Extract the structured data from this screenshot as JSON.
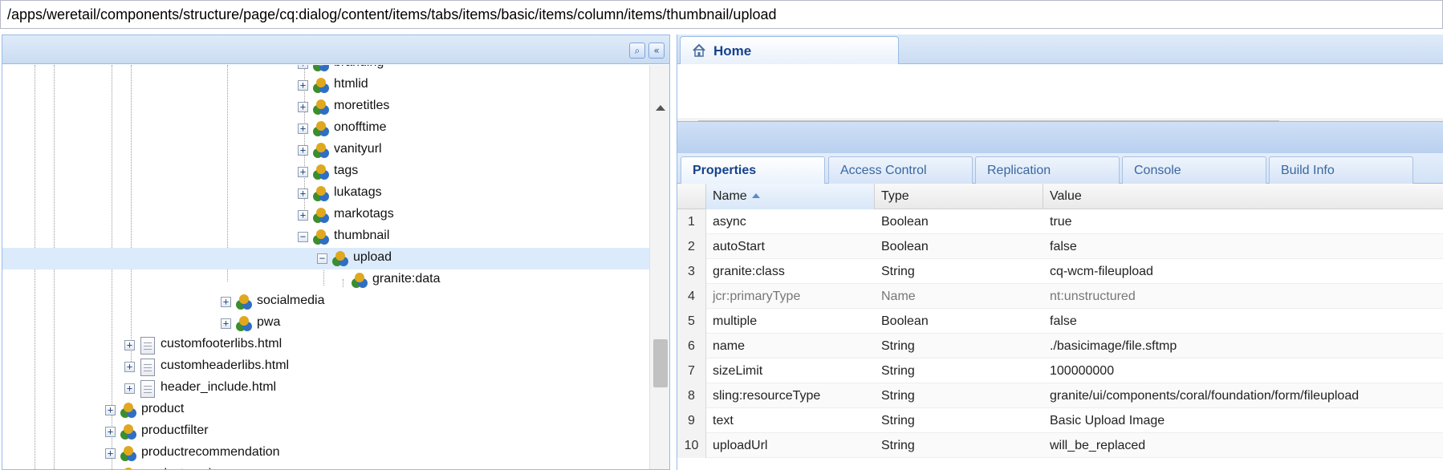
{
  "path_bar": {
    "value": "/apps/weretail/components/structure/page/cq:dialog/content/items/tabs/items/basic/items/column/items/thumbnail/upload"
  },
  "tree": {
    "nodes": [
      {
        "label": "branding",
        "expander": "+"
      },
      {
        "label": "htmlid",
        "expander": "+"
      },
      {
        "label": "moretitles",
        "expander": "+"
      },
      {
        "label": "onofftime",
        "expander": "+"
      },
      {
        "label": "vanityurl",
        "expander": "+"
      },
      {
        "label": "tags",
        "expander": "+"
      },
      {
        "label": "lukatags",
        "expander": "+"
      },
      {
        "label": "markotags",
        "expander": "+"
      },
      {
        "label": "thumbnail",
        "expander": "−"
      },
      {
        "label": "upload",
        "expander": "−"
      },
      {
        "label": "granite:data",
        "expander": ""
      },
      {
        "label": "socialmedia",
        "expander": "+"
      },
      {
        "label": "pwa",
        "expander": "+"
      },
      {
        "label": "customfooterlibs.html",
        "expander": "+"
      },
      {
        "label": "customheaderlibs.html",
        "expander": "+"
      },
      {
        "label": "header_include.html",
        "expander": "+"
      },
      {
        "label": "product",
        "expander": "+"
      },
      {
        "label": "productfilter",
        "expander": "+"
      },
      {
        "label": "productrecommendation",
        "expander": "+"
      },
      {
        "label": "productservices",
        "expander": "+"
      }
    ]
  },
  "tools": {
    "find_glyph": "⌕",
    "collapse_glyph": "«"
  },
  "home_tab": {
    "label": "Home"
  },
  "property_tabs": [
    "Properties",
    "Access Control",
    "Replication",
    "Console",
    "Build Info"
  ],
  "grid": {
    "columns": [
      "Name",
      "Type",
      "Value"
    ],
    "sorted_column": "Name",
    "rows": [
      {
        "num": "1",
        "name": "async",
        "type": "Boolean",
        "value": "true"
      },
      {
        "num": "2",
        "name": "autoStart",
        "type": "Boolean",
        "value": "false"
      },
      {
        "num": "3",
        "name": "granite:class",
        "type": "String",
        "value": "cq-wcm-fileupload"
      },
      {
        "num": "4",
        "name": "jcr:primaryType",
        "type": "Name",
        "value": "nt:unstructured"
      },
      {
        "num": "5",
        "name": "multiple",
        "type": "Boolean",
        "value": "false"
      },
      {
        "num": "6",
        "name": "name",
        "type": "String",
        "value": "./basicimage/file.sftmp"
      },
      {
        "num": "7",
        "name": "sizeLimit",
        "type": "String",
        "value": "100000000"
      },
      {
        "num": "8",
        "name": "sling:resourceType",
        "type": "String",
        "value": "granite/ui/components/coral/foundation/form/fileupload"
      },
      {
        "num": "9",
        "name": "text",
        "type": "String",
        "value": "Basic Upload Image"
      },
      {
        "num": "10",
        "name": "uploadUrl",
        "type": "String",
        "value": "will_be_replaced"
      }
    ]
  },
  "colors": {
    "panel_border": "#99bbe8",
    "tab_text": "#15428b",
    "selection": "#dcebfb"
  }
}
